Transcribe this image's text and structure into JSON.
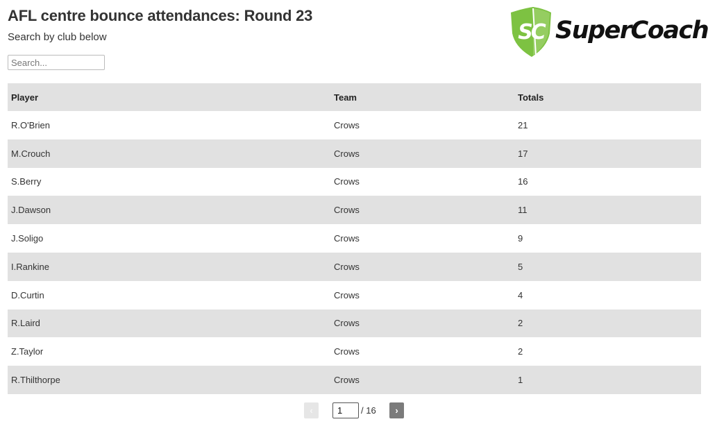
{
  "header": {
    "title": "AFL centre bounce attendances: Round 23",
    "subtitle": "Search by club below",
    "search_placeholder": "Search...",
    "search_value": ""
  },
  "logo": {
    "badge_text": "SC",
    "wordmark": "SuperCoach",
    "brand_color": "#7dc242"
  },
  "table": {
    "columns": [
      "Player",
      "Team",
      "Totals"
    ],
    "rows": [
      {
        "player": "R.O'Brien",
        "team": "Crows",
        "total": "21"
      },
      {
        "player": "M.Crouch",
        "team": "Crows",
        "total": "17"
      },
      {
        "player": "S.Berry",
        "team": "Crows",
        "total": "16"
      },
      {
        "player": "J.Dawson",
        "team": "Crows",
        "total": "11"
      },
      {
        "player": "J.Soligo",
        "team": "Crows",
        "total": "9"
      },
      {
        "player": "I.Rankine",
        "team": "Crows",
        "total": "5"
      },
      {
        "player": "D.Curtin",
        "team": "Crows",
        "total": "4"
      },
      {
        "player": "R.Laird",
        "team": "Crows",
        "total": "2"
      },
      {
        "player": "Z.Taylor",
        "team": "Crows",
        "total": "2"
      },
      {
        "player": "R.Thilthorpe",
        "team": "Crows",
        "total": "1"
      }
    ]
  },
  "pagination": {
    "prev_label": "‹",
    "next_label": "›",
    "current_page": "1",
    "total_label": "/ 16"
  }
}
